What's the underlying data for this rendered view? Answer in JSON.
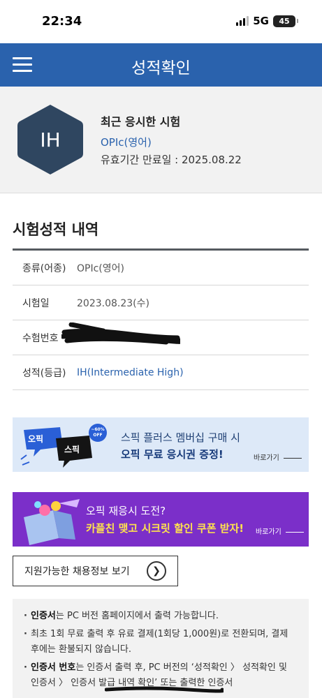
{
  "status_bar": {
    "time": "22:34",
    "network": "5G",
    "battery": "45"
  },
  "header": {
    "title": "성적확인"
  },
  "recent": {
    "badge": "IH",
    "title": "최근 응시한 시험",
    "exam": "OPIc(영어)",
    "expiry": "유효기간 만료일 : 2025.08.22"
  },
  "section": {
    "title": "시험성적 내역",
    "rows": [
      {
        "label": "종류(어종)",
        "value": "OPIc(영어)"
      },
      {
        "label": "시험일",
        "value": "2023.08.23(수)"
      },
      {
        "label": "수험번호",
        "value": ""
      },
      {
        "label": "성적(등급)",
        "value": "IH(Intermediate High)"
      }
    ]
  },
  "banner1": {
    "badge_opic": "오픽",
    "badge_speak": "스픽",
    "discount": "~60% OFF",
    "line1": "스픽 플러스 멤버십 구매 시",
    "line2": "오픽 무료 응시권 증정!",
    "more": "바로가기"
  },
  "banner2": {
    "line1": "오픽 재응시 도전?",
    "line2": "카플친 맺고 시크릿 할인 쿠폰 받자!",
    "more": "바로가기"
  },
  "jobs_button": {
    "label": "지원가능한 채용정보 보기"
  },
  "notice": {
    "items": [
      {
        "bold": "인증서",
        "text": "는 PC 버전 홈페이지에서 출력 가능합니다."
      },
      {
        "bold": "",
        "text": "최초 1회 무료 출력 후 유료 결제(1회당 1,000원)로 전환되며, 결제 후에는 환불되지 않습니다."
      },
      {
        "bold": "인증서 번호",
        "text": "는 인증서 출력 후, PC 버전의 ‘성적확인 〉 성적확인 및 인증서 〉 인증서 발급 내역 확인’ 또는 출력한 인증서"
      }
    ]
  },
  "colors": {
    "header": "#2a62ad",
    "hexagon": "#2f4660",
    "banner2_bg": "#7b2fc9",
    "banner1_bg": "#dde9f8"
  }
}
